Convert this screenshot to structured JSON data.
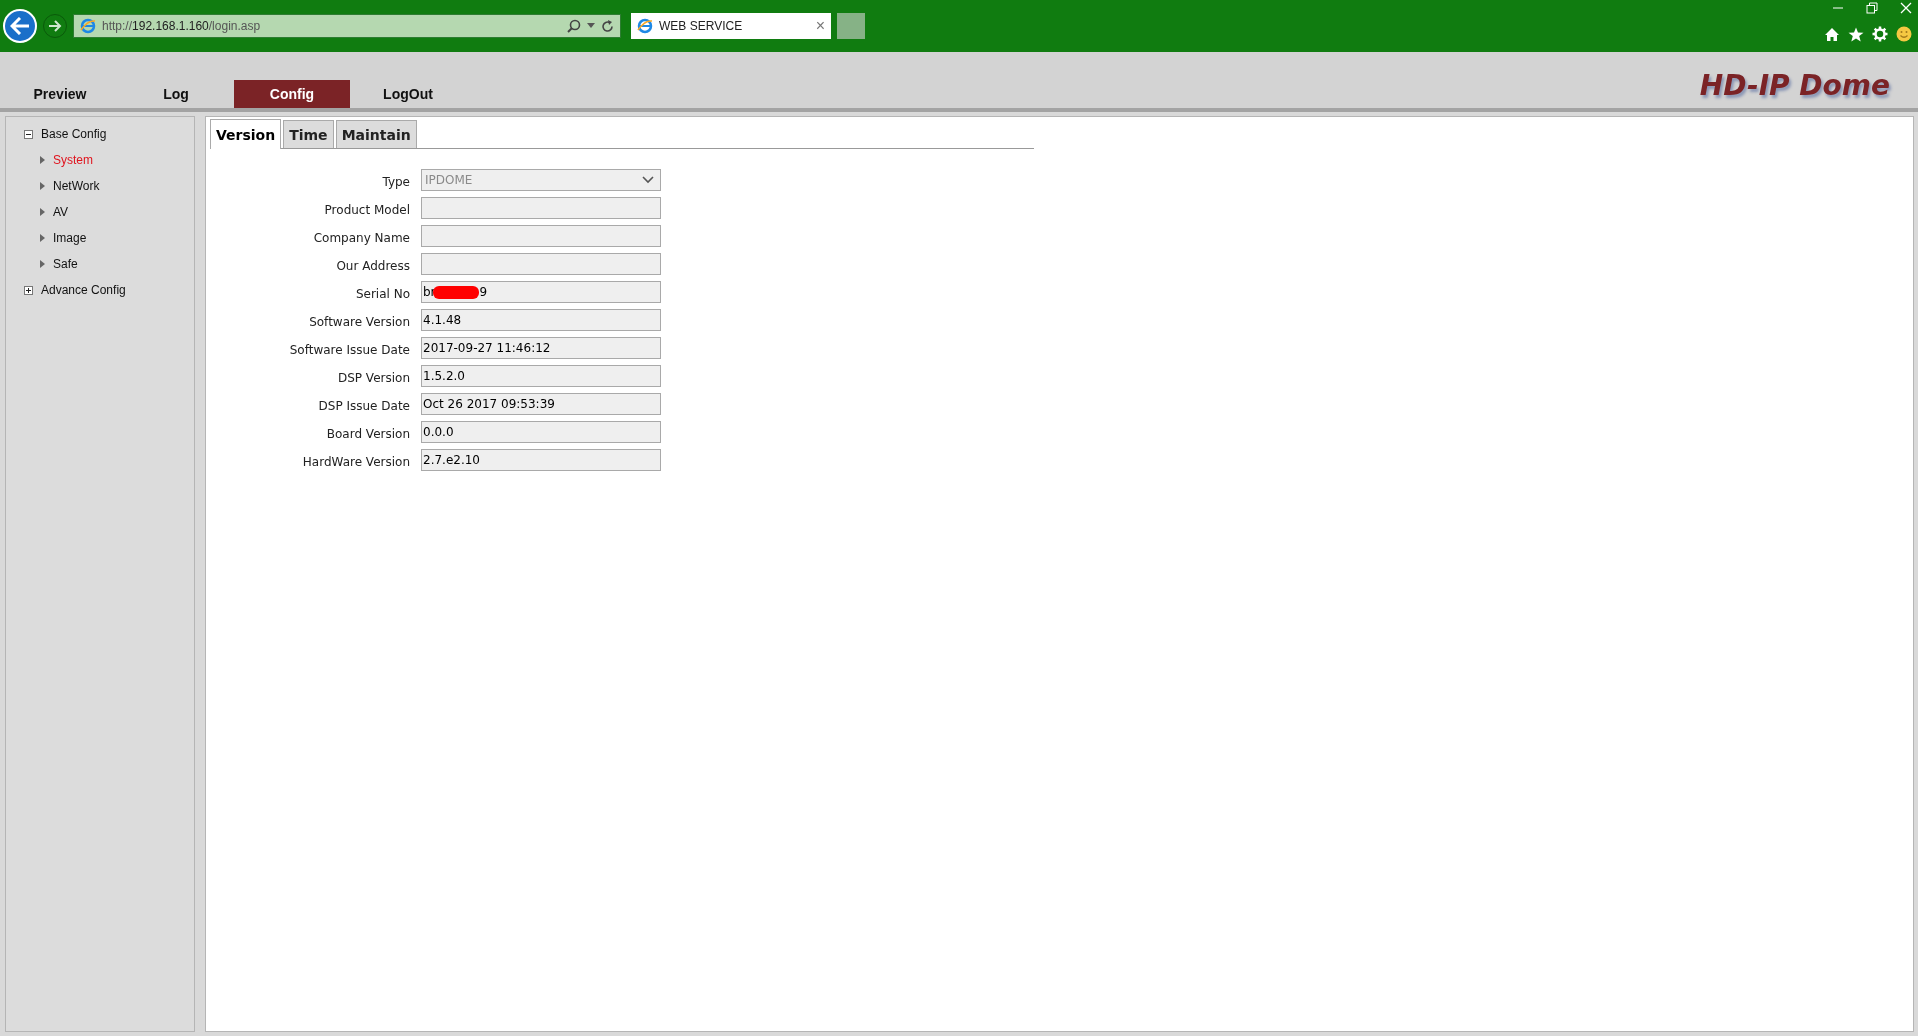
{
  "browser": {
    "address": {
      "scheme": "http://",
      "host": "192.168.1.160",
      "path": "/login.asp"
    },
    "tab": {
      "title": "WEB SERVICE",
      "close": "×"
    }
  },
  "nav": {
    "items": [
      {
        "label": "Preview",
        "selected": false
      },
      {
        "label": "Log",
        "selected": false
      },
      {
        "label": "Config",
        "selected": true
      },
      {
        "label": "LogOut",
        "selected": false
      }
    ],
    "logo": "HD-IP Dome"
  },
  "sidebar": {
    "items": [
      {
        "label": "Base Config",
        "expanded": true,
        "selected": false,
        "children": [
          {
            "label": "System",
            "selected": true
          },
          {
            "label": "NetWork",
            "selected": false
          },
          {
            "label": "AV",
            "selected": false
          },
          {
            "label": "Image",
            "selected": false
          },
          {
            "label": "Safe",
            "selected": false
          }
        ]
      },
      {
        "label": "Advance Config",
        "expanded": false,
        "selected": false
      }
    ]
  },
  "tabs": [
    {
      "label": "Version",
      "selected": true
    },
    {
      "label": "Time",
      "selected": false
    },
    {
      "label": "Maintain",
      "selected": false
    }
  ],
  "form": [
    {
      "kind": "select",
      "label": "Type",
      "value": "IPDOME",
      "disabled": true
    },
    {
      "kind": "text",
      "label": "Product Model"
    },
    {
      "kind": "text",
      "label": "Company Name"
    },
    {
      "kind": "text",
      "label": "Our Address"
    },
    {
      "kind": "redacted",
      "label": "Serial No",
      "value_start": "br",
      "value_end": "9"
    },
    {
      "kind": "text",
      "label": "Software Version",
      "value": "4.1.48"
    },
    {
      "kind": "text",
      "label": "Software Issue Date",
      "value": "2017-09-27 11:46:12"
    },
    {
      "kind": "text",
      "label": "DSP Version",
      "value": "1.5.2.0"
    },
    {
      "kind": "text",
      "label": "DSP Issue Date",
      "value": "Oct 26 2017 09:53:39"
    },
    {
      "kind": "text",
      "label": "Board Version",
      "value": "0.0.0"
    },
    {
      "kind": "text",
      "label": "HardWare Version",
      "value": "2.7.e2.10"
    }
  ]
}
